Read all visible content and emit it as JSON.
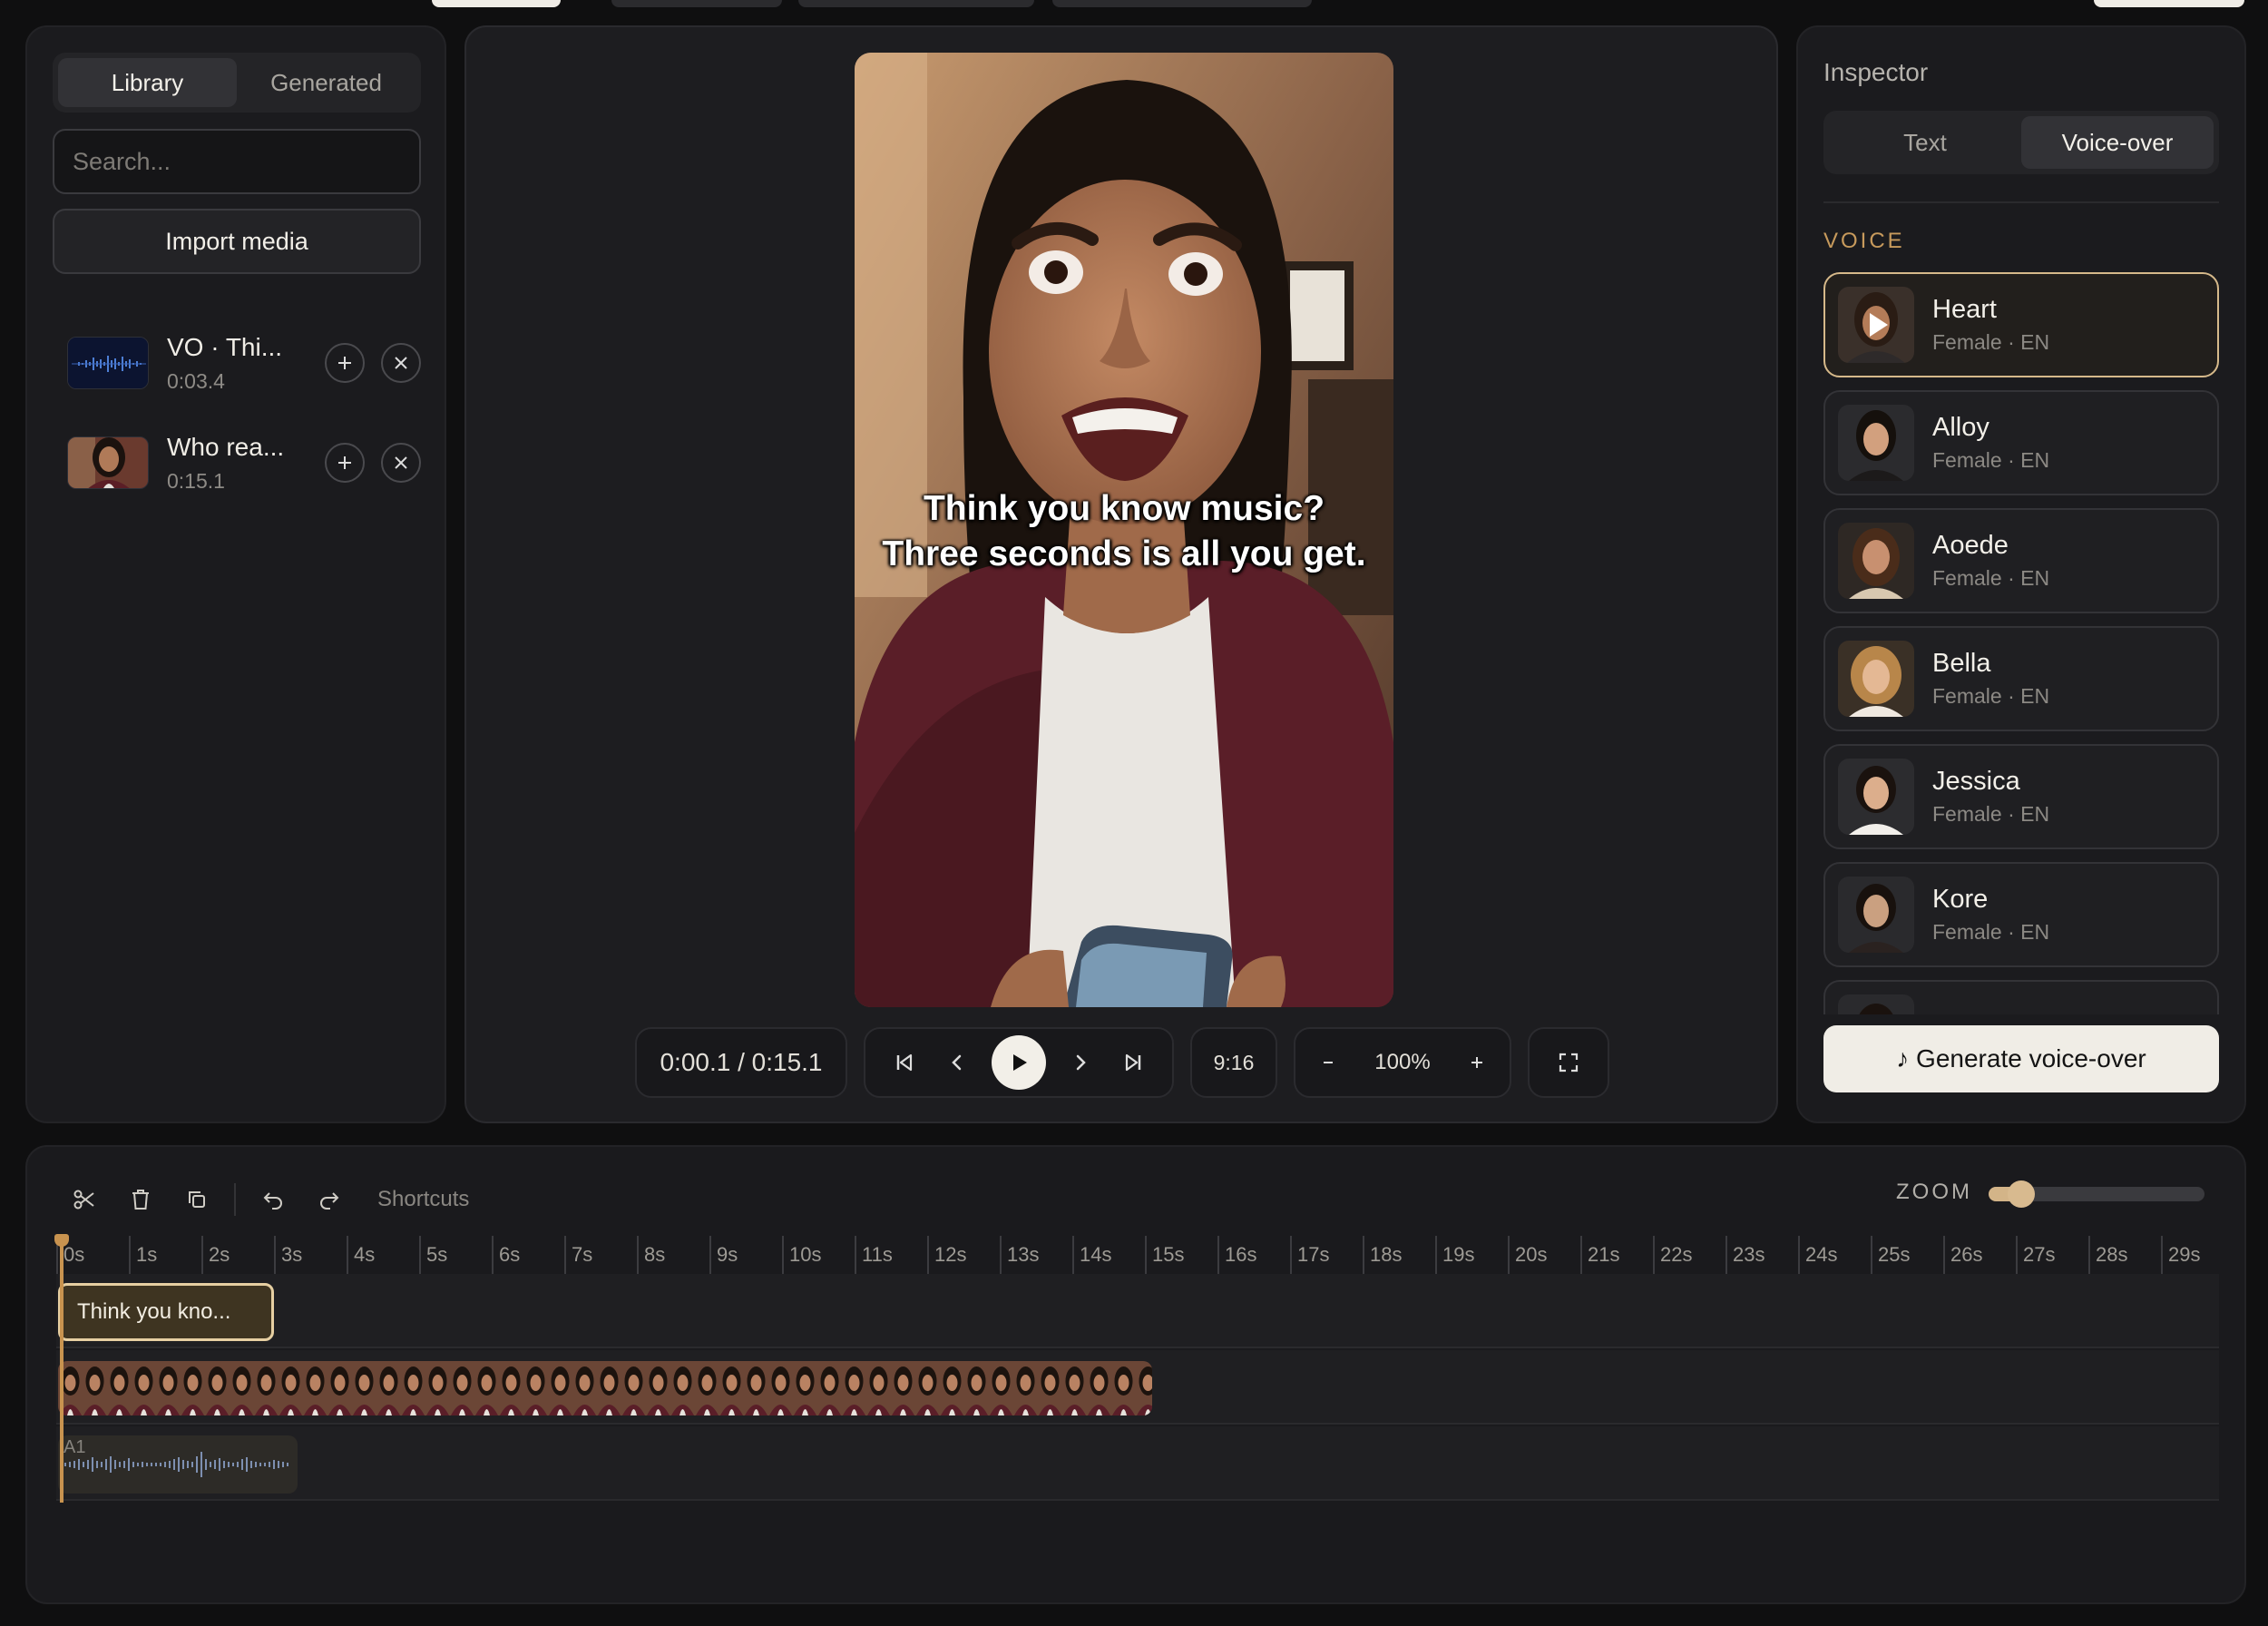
{
  "library": {
    "tabs": [
      {
        "label": "Library"
      },
      {
        "label": "Generated"
      }
    ],
    "search_placeholder": "Search...",
    "import_label": "Import media",
    "items": [
      {
        "title": "VO · Thi...",
        "duration": "0:03.4"
      },
      {
        "title": "Who rea...",
        "duration": "0:15.1"
      }
    ]
  },
  "preview": {
    "caption": "Think you know music? Three seconds is all you get.",
    "timecode": "0:00.1 / 0:15.1",
    "aspect_ratio": "9:16",
    "zoom": "100%"
  },
  "inspector": {
    "title": "Inspector",
    "tabs": [
      {
        "label": "Text"
      },
      {
        "label": "Voice-over"
      }
    ],
    "active_tab": "Voice-over",
    "voice_section_label": "VOICE",
    "voices": [
      {
        "name": "Heart",
        "meta": "Female · EN",
        "selected": true
      },
      {
        "name": "Alloy",
        "meta": "Female · EN"
      },
      {
        "name": "Aoede",
        "meta": "Female · EN"
      },
      {
        "name": "Bella",
        "meta": "Female · EN"
      },
      {
        "name": "Jessica",
        "meta": "Female · EN"
      },
      {
        "name": "Kore",
        "meta": "Female · EN"
      }
    ],
    "generate_label": "♪ Generate voice-over"
  },
  "timeline": {
    "shortcuts_label": "Shortcuts",
    "zoom_label": "ZOOM",
    "zoom_level": 0.15,
    "ticks": [
      "0s",
      "1s",
      "2s",
      "3s",
      "4s",
      "5s",
      "6s",
      "7s",
      "8s",
      "9s",
      "10s",
      "11s",
      "12s",
      "13s",
      "14s",
      "15s",
      "16s",
      "17s",
      "18s",
      "19s",
      "20s",
      "21s",
      "22s",
      "23s",
      "24s",
      "25s",
      "26s",
      "27s",
      "28s",
      "29s"
    ],
    "text_clip_label": "Think you kno...",
    "audio_track_label": "A1"
  },
  "colors": {
    "accent": "#c8934f",
    "panel": "#1b1b1e",
    "background": "#0f0f10"
  }
}
